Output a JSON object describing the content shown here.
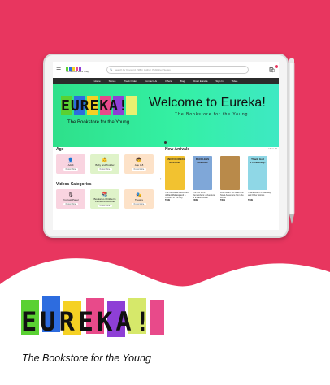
{
  "colors": {
    "background": "#e8365f",
    "hero": "#34f0a4"
  },
  "header": {
    "logo_text": "EUREKA!",
    "logo_tagline": "The Bookstore for the Young",
    "search_placeholder": "Search by Keyword, ISBN, Author, Publisher, Series"
  },
  "nav": {
    "items": [
      "Home",
      "Stores",
      "Track Order",
      "Contact Us",
      "Offers",
      "Blog",
      "About Eureka",
      "Sign In",
      "Video"
    ]
  },
  "hero": {
    "logo": "EUREKA!",
    "tagline": "The Bookstore for the Young",
    "title": "Welcome to Eureka!",
    "subtitle": "The Bookstore for the Young"
  },
  "age": {
    "title": "Age",
    "cards": [
      {
        "label": "Adult",
        "button": "Know More",
        "icon": "👤",
        "bg": "#f9d4e0"
      },
      {
        "label": "Baby and Toddler",
        "button": "Know More",
        "icon": "👶",
        "bg": "#dff3c9"
      },
      {
        "label": "Age 3-8",
        "button": "Know More",
        "icon": "🧒",
        "bg": "#fde2c8"
      }
    ]
  },
  "videos": {
    "title": "Videos Categories",
    "cards": [
      {
        "label": "Podcast Panel",
        "button": "Know More",
        "icon": "🎙",
        "bg": "#f9d4e0"
      },
      {
        "label": "Bookaroo Children's Literature Festival",
        "button": "Know More",
        "icon": "📚",
        "bg": "#dff3c9"
      },
      {
        "label": "Theatre",
        "button": "Know More",
        "icon": "🎭",
        "bg": "#fde2c8"
      }
    ]
  },
  "arrivals": {
    "title": "New Arrivals",
    "view_all": "View All",
    "books": [
      {
        "cover": "ENCYCLOPEDIA MELLOW",
        "title": "The Incredible Adventure of Ravi Maharaj and a Cyclone in the City",
        "price": "₹399",
        "color": "#f2c230"
      },
      {
        "cover": "RECKLESS DREAMS",
        "title": "The Girl Who Remembers: Adventure of a Ballot Boxer",
        "price": "₹399",
        "color": "#7fa7d8"
      },
      {
        "cover": "",
        "title": "Love Heart: Art of an Ant-Nook Adventure from the World",
        "price": "₹399",
        "color": "#b98a4a"
      },
      {
        "cover": "Thank God It's Caturday!",
        "title": "Thank God It's Caturday! and Other Stories",
        "price": "₹299",
        "color": "#8fd7e6"
      }
    ]
  },
  "brand": {
    "logo_text": "EUREKA!",
    "tagline": "The Bookstore for the Young"
  }
}
